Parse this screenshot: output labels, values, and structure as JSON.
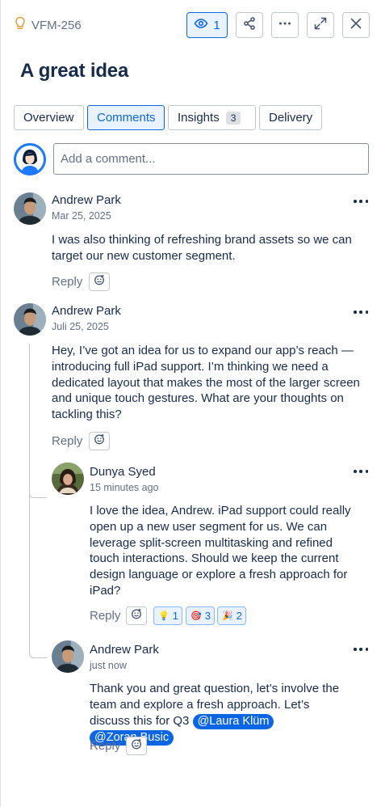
{
  "header": {
    "issue_key": "VFM-256",
    "watch_count": "1",
    "title": "A great idea"
  },
  "tabs": [
    {
      "label": "Overview"
    },
    {
      "label": "Comments",
      "active": true
    },
    {
      "label": "Insights",
      "count": "3"
    },
    {
      "label": "Delivery"
    }
  ],
  "composer": {
    "placeholder": "Add a comment..."
  },
  "comments": [
    {
      "author": "Andrew Park",
      "date": "Mar 25, 2025",
      "body": "I was also thinking of refreshing brand assets so we can target our new customer segment.",
      "reply_label": "Reply"
    },
    {
      "author": "Andrew Park",
      "date": "Juli 25, 2025",
      "body": "Hey, I’ve got an idea for us to expand our app’s reach — introducing full iPad support. I’m thinking we need a dedicated layout that makes the most of the larger screen and unique touch gestures. What are your thoughts on tackling this?",
      "reply_label": "Reply",
      "replies": [
        {
          "author": "Dunya Syed",
          "date": "15 minutes ago",
          "body": "I love the idea, Andrew. iPad support could really open up a new user segment for us. We can leverage split-screen multitasking and refined touch interactions. Should we keep the current design language or explore a fresh approach for iPad?",
          "reply_label": "Reply",
          "reactions": [
            {
              "emoji": "💡",
              "count": "1"
            },
            {
              "emoji": "🎯",
              "count": "3"
            },
            {
              "emoji": "🎉",
              "count": "2"
            }
          ]
        },
        {
          "author": "Andrew Park",
          "date": "just now",
          "body": "Thank you and great question, let’s involve the team and explore a fresh approach. Let’s discuss this for Q3",
          "mentions": [
            "@Laura Klüm",
            "@Zoran Busic"
          ],
          "reply_label": "Reply"
        }
      ]
    }
  ],
  "colors": {
    "accent": "#0c66e4",
    "accent_bg": "#e9f2ff",
    "text": "#172b4d",
    "subtle": "#626f86",
    "border": "#c1c7d0"
  }
}
